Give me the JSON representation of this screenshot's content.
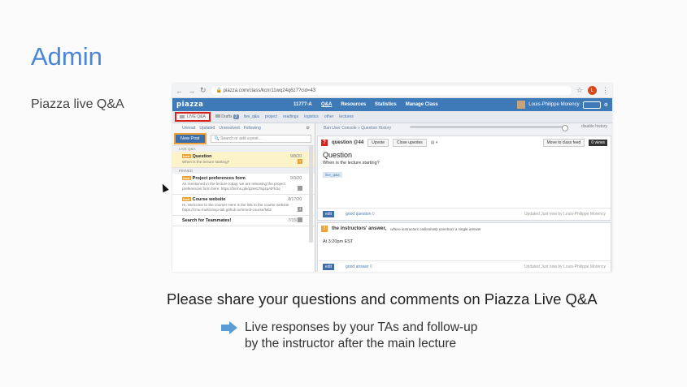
{
  "slide": {
    "title": "Admin",
    "subtitle": "Piazza live Q&A",
    "message": "Please share your questions and comments on Piazza Live Q&A",
    "bullet_line1": "Live responses by your TAs and follow-up",
    "bullet_line2": "by the instructor after the main lecture"
  },
  "browser": {
    "url": "piazza.com/class/kcnr11wq24q6z7?cid=43",
    "avatar_letter": "L"
  },
  "piazza": {
    "logo": "piazza",
    "course": "11777-A",
    "nav": [
      "Q&A",
      "Resources",
      "Statistics",
      "Manage Class"
    ],
    "user": "Louis-Philippe Morency",
    "live_qa": "LIVE Q&A",
    "drafts": "Drafts",
    "drafts_count": "2",
    "folders": [
      "live_q&a",
      "project",
      "readings",
      "logistics",
      "other",
      "lectures"
    ],
    "filters": [
      "Unread",
      "Updated",
      "Unresolved",
      "Following"
    ],
    "new_post": "New Post",
    "search_placeholder": "Search or add a post...",
    "section_live": "LIVE Q&A",
    "section_pinned": "PINNED",
    "posts": [
      {
        "tag": "Instr",
        "title": "Question",
        "date": "9/8/20",
        "preview": "When is the lecture starting?",
        "count": "1"
      },
      {
        "tag": "Instr",
        "title": "Project preferences form",
        "date": "9/3/20",
        "preview": "As mentioned in the lecture today, we are releasing the project preferences form here: https://forms.gle/q2eKt75pzpAlFk3q",
        "count": ""
      },
      {
        "tag": "Instr",
        "title": "Course website",
        "date": "8/17/20",
        "preview": "Hi, Welcome to the course! Here is the link to the course website https://cmu-multicomp-lab.github.io/mmml-course/fall2",
        "count": "3"
      },
      {
        "tag": "",
        "title": "Search for Teammates!",
        "date": "7/15/20",
        "preview": "",
        "count": ""
      }
    ],
    "breadcrumb": "Ban User Console » Question History",
    "disable_history": "disable history",
    "question": {
      "label": "question @44",
      "upvote": "Upvote",
      "close_upvotes": "Close upvotes",
      "move": "Move to class feed",
      "views": "0 views",
      "title": "Question",
      "body": "When is the lecture starting?",
      "chip": "live_q&a",
      "edit": "edit",
      "good": "good question",
      "good_count": "0",
      "updated": "Updated Just now by Louis-Philippe Morency"
    },
    "answer": {
      "label": "the instructors' answer,",
      "desc": "where instructors collectively construct a single answer",
      "body": "At 3:20pm EST",
      "edit": "edit",
      "good": "good answer",
      "good_count": "0",
      "updated": "Updated Just now by Louis-Philippe Morency"
    }
  },
  "colors": {
    "accent": "#4a86d8",
    "piazza_bar": "#3e7ab8",
    "highlight_red": "#d9211b",
    "highlight_orange": "#f0a23a"
  }
}
